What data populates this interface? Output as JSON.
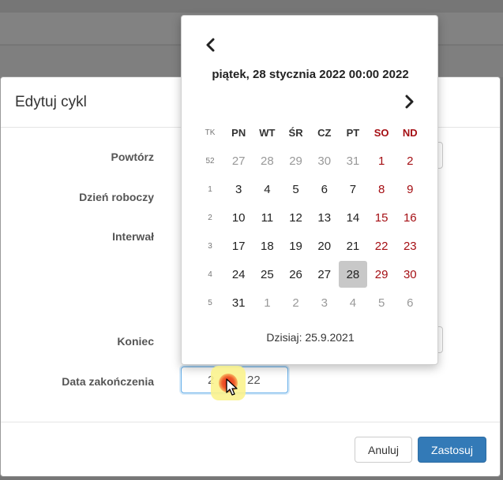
{
  "modal": {
    "title": "Edytuj cykl",
    "labels": {
      "repeat": "Powtórz",
      "workday": "Dzień roboczy",
      "interval": "Interwał",
      "end": "Koniec",
      "end_date": "Data zakończenia"
    },
    "end_date_value_left": "2",
    "end_date_value_right": "22",
    "buttons": {
      "cancel": "Anuluj",
      "apply": "Zastosuj"
    }
  },
  "datepicker": {
    "title": "piątek, 28 stycznia 2022 00:00 2022",
    "headers": [
      "TK",
      "PN",
      "WT",
      "ŚR",
      "CZ",
      "PT",
      "SO",
      "ND"
    ],
    "weeks": [
      {
        "wk": "52",
        "days": [
          "27",
          "28",
          "29",
          "30",
          "31",
          "1",
          "2"
        ],
        "muted": [
          true,
          true,
          true,
          true,
          true,
          false,
          false
        ]
      },
      {
        "wk": "1",
        "days": [
          "3",
          "4",
          "5",
          "6",
          "7",
          "8",
          "9"
        ],
        "muted": [
          false,
          false,
          false,
          false,
          false,
          false,
          false
        ]
      },
      {
        "wk": "2",
        "days": [
          "10",
          "11",
          "12",
          "13",
          "14",
          "15",
          "16"
        ],
        "muted": [
          false,
          false,
          false,
          false,
          false,
          false,
          false
        ]
      },
      {
        "wk": "3",
        "days": [
          "17",
          "18",
          "19",
          "20",
          "21",
          "22",
          "23"
        ],
        "muted": [
          false,
          false,
          false,
          false,
          false,
          false,
          false
        ]
      },
      {
        "wk": "4",
        "days": [
          "24",
          "25",
          "26",
          "27",
          "28",
          "29",
          "30"
        ],
        "muted": [
          false,
          false,
          false,
          false,
          false,
          false,
          false
        ]
      },
      {
        "wk": "5",
        "days": [
          "31",
          "1",
          "2",
          "3",
          "4",
          "5",
          "6"
        ],
        "muted": [
          false,
          true,
          true,
          true,
          true,
          true,
          true
        ]
      }
    ],
    "selected_day": "28",
    "today_label": "Dzisiaj: 25.9.2021",
    "icons": {
      "prev": "chevron-left-icon",
      "next": "chevron-right-icon"
    }
  },
  "colors": {
    "primary": "#337ab7",
    "weekend": "#a50f14",
    "selected": "#c8c8c8"
  }
}
